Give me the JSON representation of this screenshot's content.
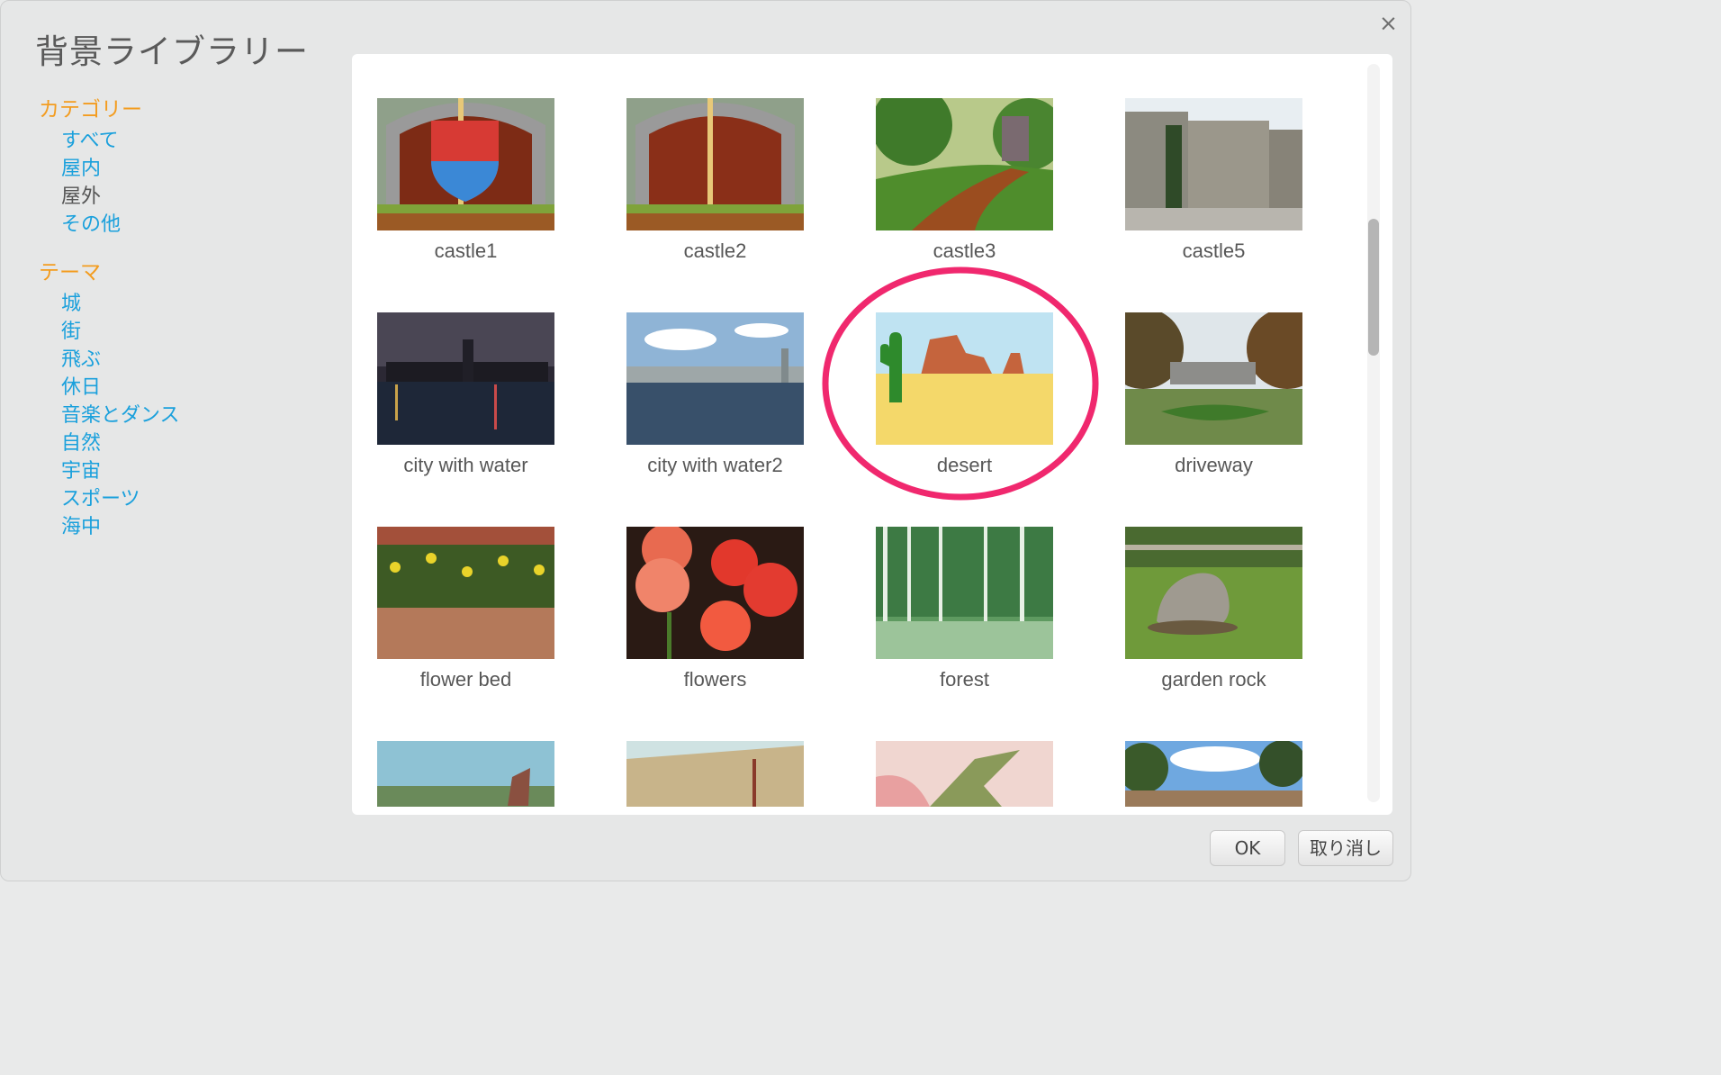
{
  "dialog": {
    "title": "背景ライブラリー",
    "close_glyph": "×",
    "close_icon": "close-icon"
  },
  "sidebar": {
    "category_header": "カテゴリー",
    "categories": [
      "すべて",
      "屋内",
      "屋外",
      "その他"
    ],
    "selected_category": "屋外",
    "theme_header": "テーマ",
    "themes": [
      "城",
      "街",
      "飛ぶ",
      "休日",
      "音楽とダンス",
      "自然",
      "宇宙",
      "スポーツ",
      "海中"
    ]
  },
  "library": {
    "items": [
      {
        "label": "castle1"
      },
      {
        "label": "castle2"
      },
      {
        "label": "castle3"
      },
      {
        "label": "castle5"
      },
      {
        "label": "city with water"
      },
      {
        "label": "city with water2"
      },
      {
        "label": "desert"
      },
      {
        "label": "driveway"
      },
      {
        "label": "flower bed"
      },
      {
        "label": "flowers"
      },
      {
        "label": "forest"
      },
      {
        "label": "garden rock"
      },
      {
        "label": ""
      },
      {
        "label": ""
      },
      {
        "label": ""
      },
      {
        "label": ""
      }
    ],
    "highlighted_item": "desert",
    "highlight_color": "#f0286e"
  },
  "footer": {
    "ok_label": "OK",
    "cancel_label": "取り消し"
  },
  "colors": {
    "category_header": "#f39c1f",
    "link": "#1aa0dc",
    "selected": "#555555"
  }
}
